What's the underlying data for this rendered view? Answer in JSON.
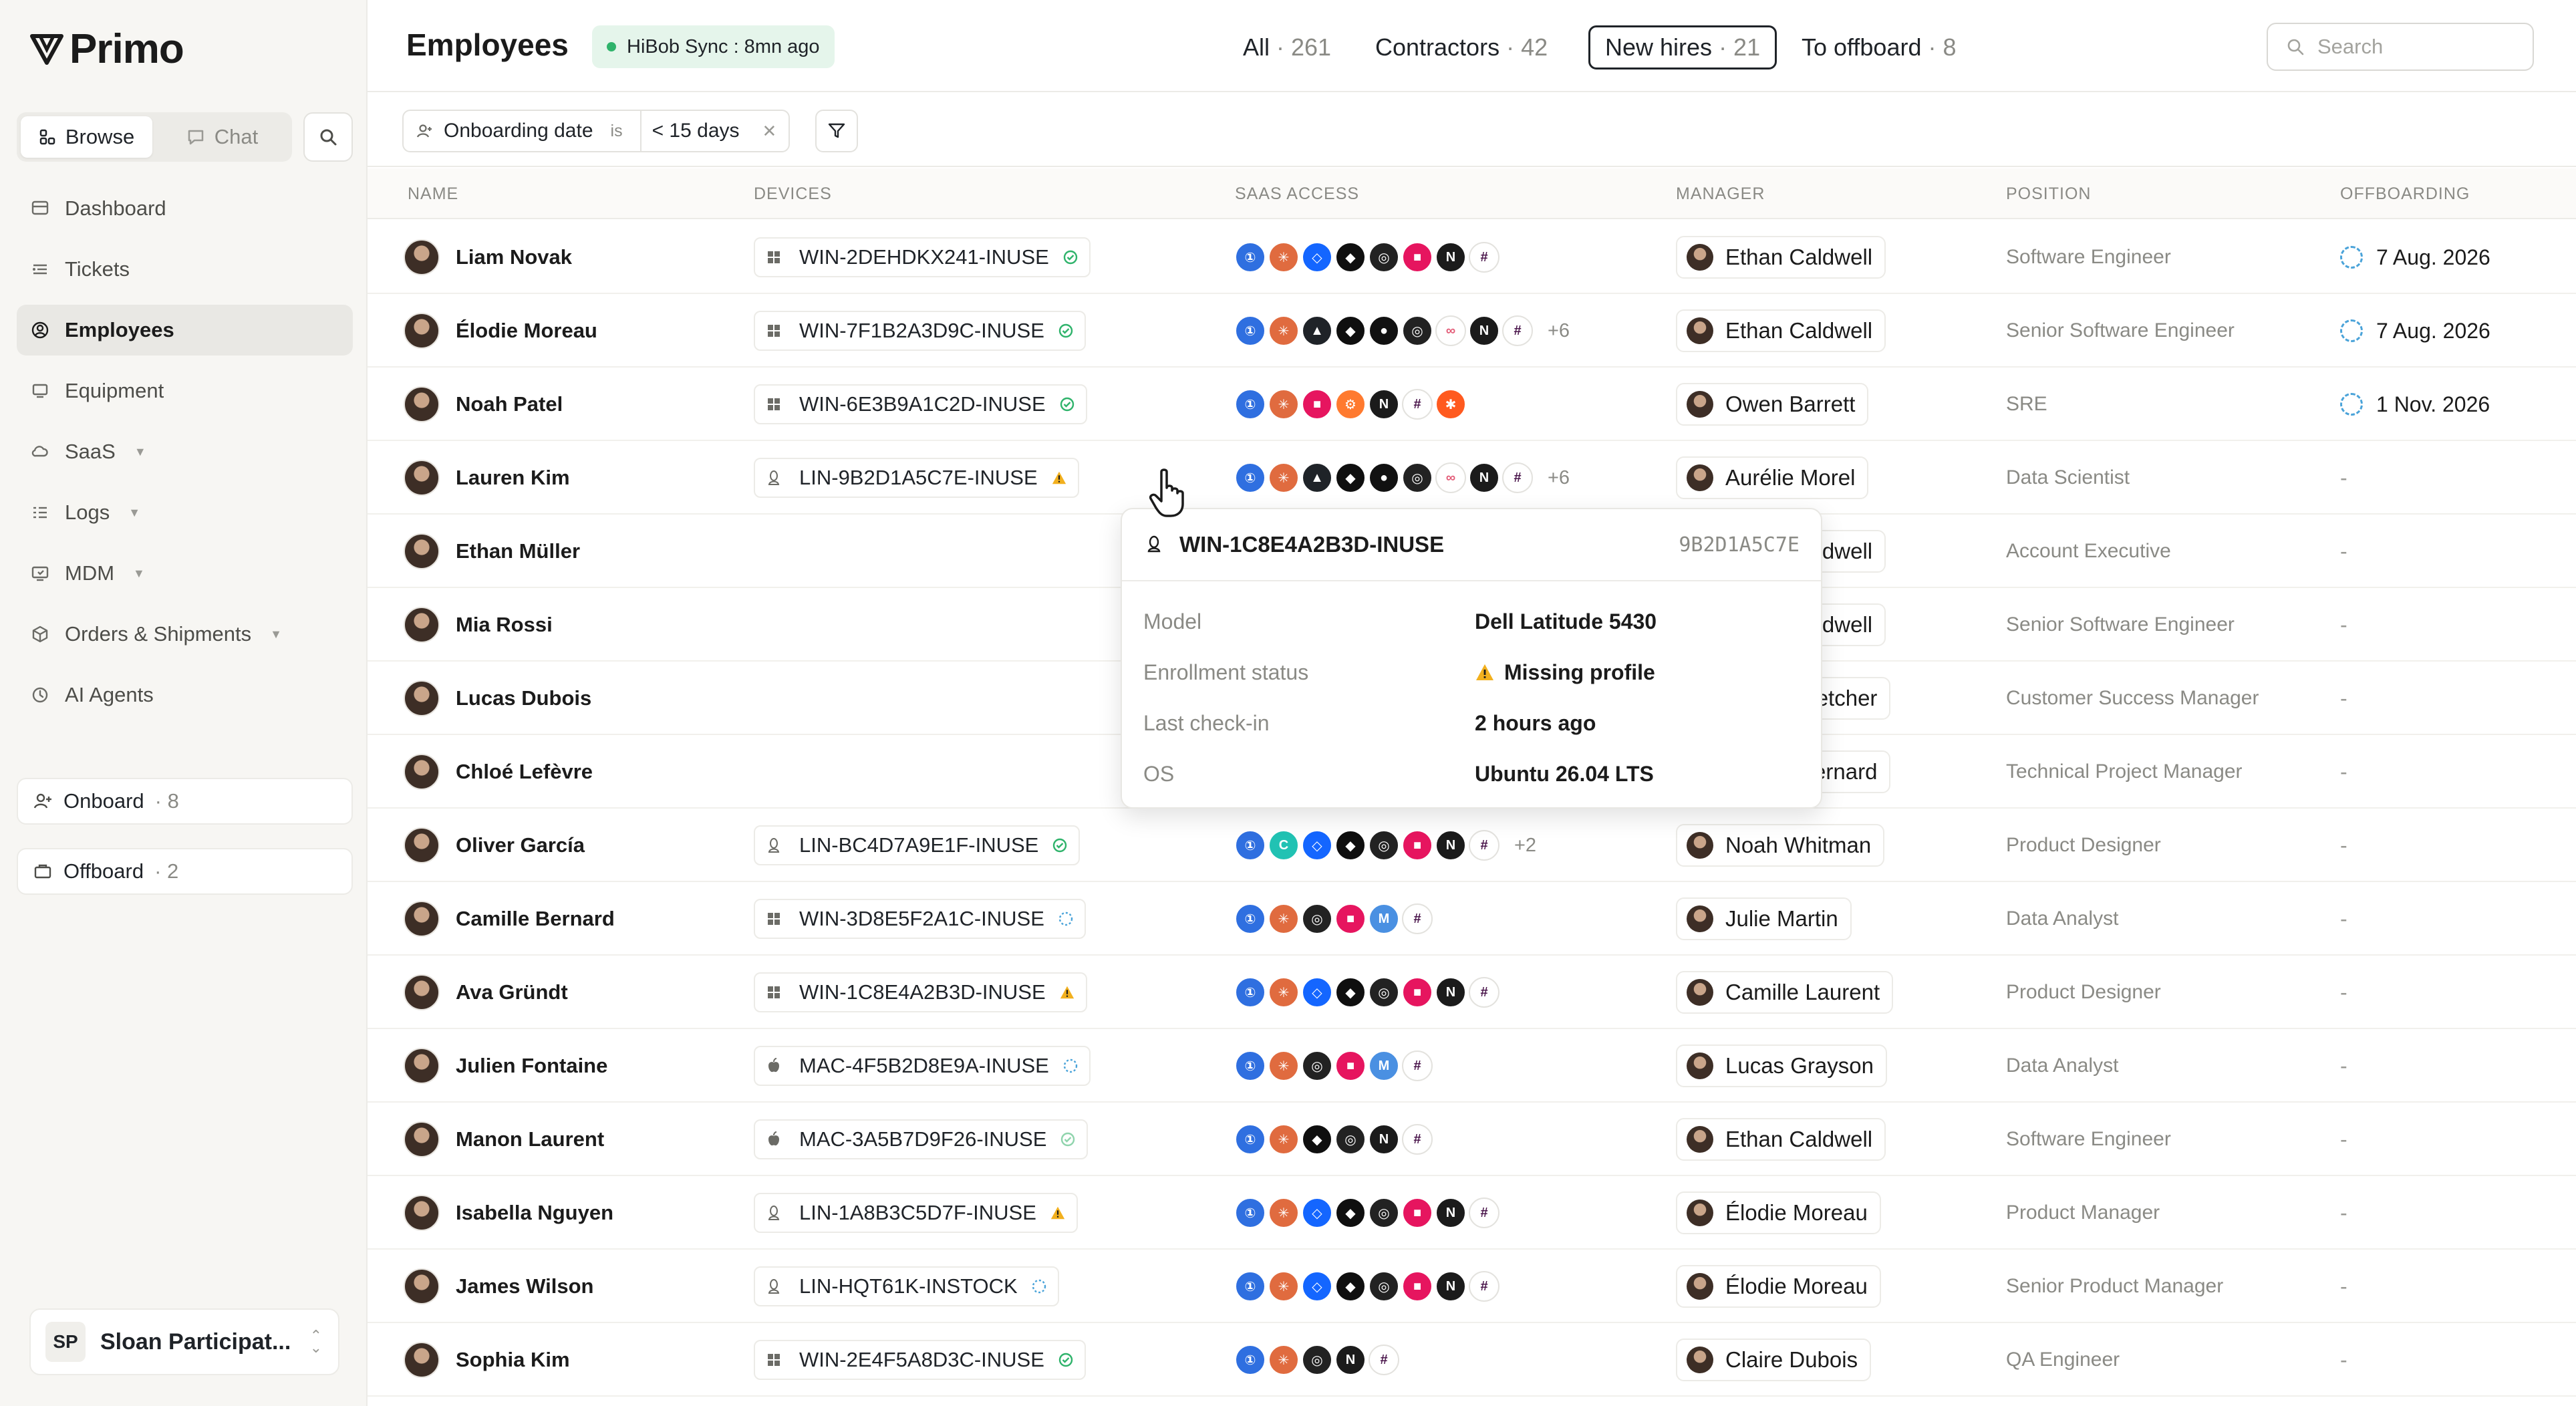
{
  "app": {
    "logo": "Primo"
  },
  "sidebar": {
    "modes": [
      {
        "label": "Browse",
        "active": true
      },
      {
        "label": "Chat",
        "active": false
      }
    ],
    "nav": [
      {
        "label": "Dashboard",
        "icon": "dashboard-icon"
      },
      {
        "label": "Tickets",
        "icon": "tickets-icon"
      },
      {
        "label": "Employees",
        "icon": "employees-icon",
        "active": true
      },
      {
        "label": "Equipment",
        "icon": "equipment-icon"
      },
      {
        "label": "SaaS",
        "icon": "saas-icon",
        "caret": true
      },
      {
        "label": "Logs",
        "icon": "logs-icon",
        "caret": true
      },
      {
        "label": "MDM",
        "icon": "mdm-icon",
        "caret": true
      },
      {
        "label": "Orders & Shipments",
        "icon": "orders-icon",
        "caret": true
      },
      {
        "label": "AI Agents",
        "icon": "ai-agents-icon"
      }
    ],
    "onboard": {
      "label": "Onboard",
      "count": "· 8"
    },
    "offboard": {
      "label": "Offboard",
      "count": "· 2"
    },
    "workspace": {
      "initials": "SP",
      "name": "Sloan Participat..."
    }
  },
  "header": {
    "title": "Employees",
    "sync": "HiBob Sync : 8mn ago",
    "tabs": [
      {
        "label": "All",
        "count": "· 261"
      },
      {
        "label": "Contractors",
        "count": "· 42"
      },
      {
        "label": "New hires",
        "count": "· 21",
        "active": true
      },
      {
        "label": "To offboard",
        "count": "· 8"
      }
    ],
    "search_placeholder": "Search"
  },
  "filter": {
    "field": "Onboarding date",
    "op": "is",
    "value": "< 15 days"
  },
  "columns": [
    "NAME",
    "DEVICES",
    "SAAS ACCESS",
    "MANAGER",
    "POSITION",
    "OFFBOARDING"
  ],
  "colors": {
    "green": "#2fb36b",
    "warning": "#f2b01e",
    "pending": "#4aa3d9",
    "accent": "#1f2328"
  },
  "saas_colors": {
    "1p": "#2f6fe0",
    "claude": "#e06b3f",
    "figma": "#0f0f0f",
    "stripe": "#1f2328",
    "linear": "#222222",
    "notion": "#1b1b1b",
    "slack": "#ffffff",
    "dropbox": "#1466ff",
    "github": "#111111",
    "zapier": "#ff5a1f",
    "hubspot": "#ff7a2f",
    "make": "#e6155f",
    "canva": "#21c2b3",
    "miro": "#4a90e2",
    "amplitude": "#ffffff"
  },
  "rows": [
    {
      "name": "Liam Novak",
      "os": "windows",
      "device": "WIN-2DEHDKX241-INUSE",
      "status": "ok",
      "saas": [
        "1p",
        "claude",
        "dropbox",
        "figma",
        "linear",
        "make",
        "notion",
        "slack"
      ],
      "more": "",
      "manager": "Ethan Caldwell",
      "position": "Software Engineer",
      "offboarding": "7 Aug. 2026"
    },
    {
      "name": "Élodie Moreau",
      "os": "windows",
      "device": "WIN-7F1B2A3D9C-INUSE",
      "status": "ok",
      "saas": [
        "1p",
        "claude",
        "stripe",
        "figma",
        "github",
        "linear",
        "amplitude",
        "notion",
        "slack"
      ],
      "more": "+6",
      "manager": "Ethan Caldwell",
      "position": "Senior Software Engineer",
      "offboarding": "7 Aug. 2026"
    },
    {
      "name": "Noah Patel",
      "os": "windows",
      "device": "WIN-6E3B9A1C2D-INUSE",
      "status": "ok",
      "saas": [
        "1p",
        "claude",
        "make",
        "hubspot",
        "notion",
        "slack",
        "zapier"
      ],
      "more": "",
      "manager": "Owen Barrett",
      "position": "SRE",
      "offboarding": "1 Nov. 2026"
    },
    {
      "name": "Lauren Kim",
      "os": "linux",
      "device": "LIN-9B2D1A5C7E-INUSE",
      "status": "warn",
      "saas": [
        "1p",
        "claude",
        "stripe",
        "figma",
        "github",
        "linear",
        "amplitude",
        "notion",
        "slack"
      ],
      "more": "+6",
      "manager": "Aurélie Morel",
      "position": "Data Scientist",
      "offboarding": "-"
    },
    {
      "name": "Ethan Müller",
      "os": "windows",
      "device": "",
      "status": "",
      "saas": [
        "zapier"
      ],
      "more": "",
      "manager": "Ethan Caldwell",
      "position": "Account Executive",
      "offboarding": "-"
    },
    {
      "name": "Mia Rossi",
      "os": "windows",
      "device": "",
      "status": "",
      "saas": [
        "notion",
        "slack"
      ],
      "more": "",
      "manager": "Ethan Caldwell",
      "position": "Senior Software Engineer",
      "offboarding": "-"
    },
    {
      "name": "Lucas Dubois",
      "os": "windows",
      "device": "",
      "status": "",
      "saas": [
        "zapier"
      ],
      "more": "",
      "manager": "Mason Fletcher",
      "position": "Customer Success Manager",
      "offboarding": "-"
    },
    {
      "name": "Chloé Lefèvre",
      "os": "windows",
      "device": "",
      "status": "",
      "saas": [
        "zapier"
      ],
      "more": "",
      "manager": "Amélie Bernard",
      "position": "Technical Project Manager",
      "offboarding": "-"
    },
    {
      "name": "Oliver García",
      "os": "linux",
      "device": "LIN-BC4D7A9E1F-INUSE",
      "status": "ok",
      "saas": [
        "1p",
        "canva",
        "dropbox",
        "figma",
        "linear",
        "make",
        "notion",
        "slack"
      ],
      "more": "+2",
      "manager": "Noah Whitman",
      "position": "Product Designer",
      "offboarding": "-"
    },
    {
      "name": "Camille Bernard",
      "os": "windows",
      "device": "WIN-3D8E5F2A1C-INUSE",
      "status": "pending",
      "saas": [
        "1p",
        "claude",
        "linear",
        "make",
        "miro",
        "slack"
      ],
      "more": "",
      "manager": "Julie Martin",
      "position": "Data Analyst",
      "offboarding": "-"
    },
    {
      "name": "Ava Gründt",
      "os": "windows",
      "device": "WIN-1C8E4A2B3D-INUSE",
      "status": "warn",
      "saas": [
        "1p",
        "claude",
        "dropbox",
        "figma",
        "linear",
        "make",
        "notion",
        "slack"
      ],
      "more": "",
      "manager": "Camille Laurent",
      "position": "Product Designer",
      "offboarding": "-"
    },
    {
      "name": "Julien Fontaine",
      "os": "mac",
      "device": "MAC-4F5B2D8E9A-INUSE",
      "status": "pending",
      "saas": [
        "1p",
        "claude",
        "linear",
        "make",
        "miro",
        "slack"
      ],
      "more": "",
      "manager": "Lucas Grayson",
      "position": "Data Analyst",
      "offboarding": "-"
    },
    {
      "name": "Manon Laurent",
      "os": "mac",
      "device": "MAC-3A5B7D9F26-INUSE",
      "status": "ok-light",
      "saas": [
        "1p",
        "claude",
        "figma",
        "linear",
        "notion",
        "slack"
      ],
      "more": "",
      "manager": "Ethan Caldwell",
      "position": "Software Engineer",
      "offboarding": "-"
    },
    {
      "name": "Isabella Nguyen",
      "os": "linux",
      "device": "LIN-1A8B3C5D7F-INUSE",
      "status": "warn",
      "saas": [
        "1p",
        "claude",
        "dropbox",
        "figma",
        "linear",
        "make",
        "notion",
        "slack"
      ],
      "more": "",
      "manager": "Élodie Moreau",
      "position": "Product Manager",
      "offboarding": "-"
    },
    {
      "name": "James Wilson",
      "os": "linux",
      "device": "LIN-HQT61K-INSTOCK",
      "status": "pending",
      "saas": [
        "1p",
        "claude",
        "dropbox",
        "figma",
        "linear",
        "make",
        "notion",
        "slack"
      ],
      "more": "",
      "manager": "Élodie Moreau",
      "position": "Senior Product Manager",
      "offboarding": "-"
    },
    {
      "name": "Sophia Kim",
      "os": "windows",
      "device": "WIN-2E4F5A8D3C-INUSE",
      "status": "ok",
      "saas": [
        "1p",
        "claude",
        "linear",
        "notion",
        "slack"
      ],
      "more": "",
      "manager": "Claire Dubois",
      "position": "QA Engineer",
      "offboarding": "-"
    }
  ],
  "popover": {
    "title": "WIN-1C8E4A2B3D-INUSE",
    "id": "9B2D1A5C7E",
    "fields": [
      {
        "key": "Model",
        "value": "Dell Latitude 5430"
      },
      {
        "key": "Enrollment status",
        "value": "Missing profile",
        "warn": true
      },
      {
        "key": "Last check-in",
        "value": "2 hours ago"
      },
      {
        "key": "OS",
        "value": "Ubuntu 26.04 LTS"
      }
    ]
  }
}
